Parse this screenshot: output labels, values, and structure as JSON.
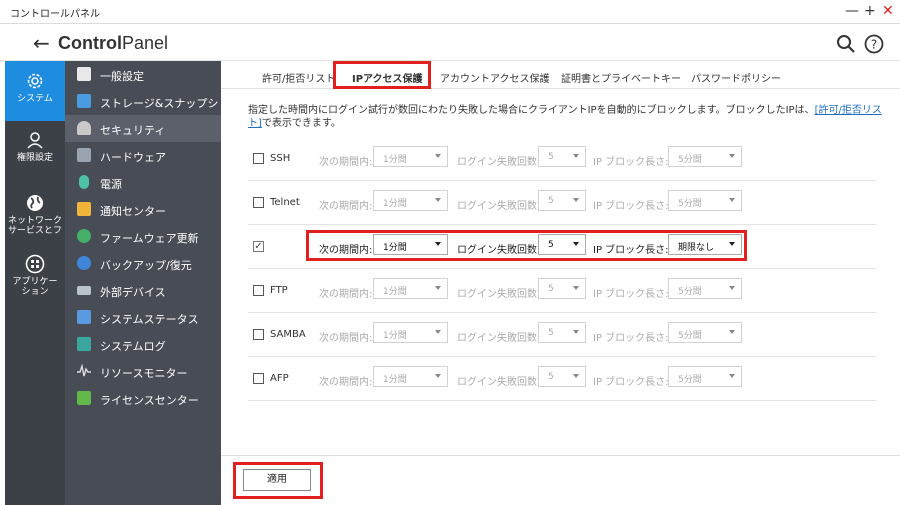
{
  "window": {
    "title": "コントロールパネル",
    "minimize": "—",
    "maximize": "+",
    "close": "✕"
  },
  "header": {
    "title_bold": "Control",
    "title_rest": "Panel"
  },
  "rail": [
    {
      "label": "システム",
      "icon": "gear-icon",
      "active": true
    },
    {
      "label": "権限設定",
      "icon": "user-icon",
      "active": false
    },
    {
      "label": "ネットワーク\nサービスとフ",
      "icon": "globe-icon",
      "active": false
    },
    {
      "label": "アプリケー\nション",
      "icon": "apps-icon",
      "active": false
    }
  ],
  "sidebar": {
    "items": [
      {
        "label": "一般設定",
        "icon": "general-settings-icon",
        "color": "#e8e8e8"
      },
      {
        "label": "ストレージ&スナップシ...",
        "icon": "storage-icon",
        "color": "#4a9be0"
      },
      {
        "label": "セキュリティ",
        "icon": "security-icon",
        "color": "#c9c9c9",
        "active": true
      },
      {
        "label": "ハードウェア",
        "icon": "hardware-icon",
        "color": "#9aa4b0"
      },
      {
        "label": "電源",
        "icon": "power-icon",
        "color": "#4cc3a5"
      },
      {
        "label": "通知センター",
        "icon": "notification-icon",
        "color": "#f0b43a"
      },
      {
        "label": "ファームウェア更新",
        "icon": "firmware-icon",
        "color": "#46b06a"
      },
      {
        "label": "バックアップ/復元",
        "icon": "backup-icon",
        "color": "#3f86d8"
      },
      {
        "label": "外部デバイス",
        "icon": "external-device-icon",
        "color": "#b9c3cc"
      },
      {
        "label": "システムステータス",
        "icon": "system-status-icon",
        "color": "#5a9ae0"
      },
      {
        "label": "システムログ",
        "icon": "system-log-icon",
        "color": "#3aa6a0"
      },
      {
        "label": "リソースモニター",
        "icon": "resource-monitor-icon",
        "color": "#6c6c6c"
      },
      {
        "label": "ライセンスセンター",
        "icon": "license-icon",
        "color": "#62b84a"
      }
    ]
  },
  "tabs": [
    {
      "label": "許可/拒否リスト",
      "active": false
    },
    {
      "label": "IPアクセス保護",
      "active": true
    },
    {
      "label": "アカウントアクセス保護",
      "active": false
    },
    {
      "label": "証明書とプライベートキー",
      "active": false
    },
    {
      "label": "パスワードポリシー",
      "active": false
    }
  ],
  "description": {
    "text1": "指定した時間内にログイン試行が数回にわたり失敗した場合にクライアントIPを自動的にブロックします。ブロックしたIPは、",
    "link": "[許可/拒否リスト]",
    "text2": "で表示できます。"
  },
  "labels": {
    "period": "次の期間内:",
    "failures": "ログイン失敗回数:",
    "block": "IP ブロック長さ:"
  },
  "services": [
    {
      "name": "SSH",
      "checked": false,
      "period": "1分間",
      "failures": "5",
      "block": "5分間"
    },
    {
      "name": "Telnet",
      "checked": false,
      "period": "1分間",
      "failures": "5",
      "block": "5分間"
    },
    {
      "name": "",
      "checked": true,
      "period": "1分間",
      "failures": "5",
      "block": "期限なし"
    },
    {
      "name": "FTP",
      "checked": false,
      "period": "1分間",
      "failures": "5",
      "block": "5分間"
    },
    {
      "name": "SAMBA",
      "checked": false,
      "period": "1分間",
      "failures": "5",
      "block": "5分間"
    },
    {
      "name": "AFP",
      "checked": false,
      "period": "1分間",
      "failures": "5",
      "block": "5分間"
    }
  ],
  "footer": {
    "apply_label": "適用"
  }
}
